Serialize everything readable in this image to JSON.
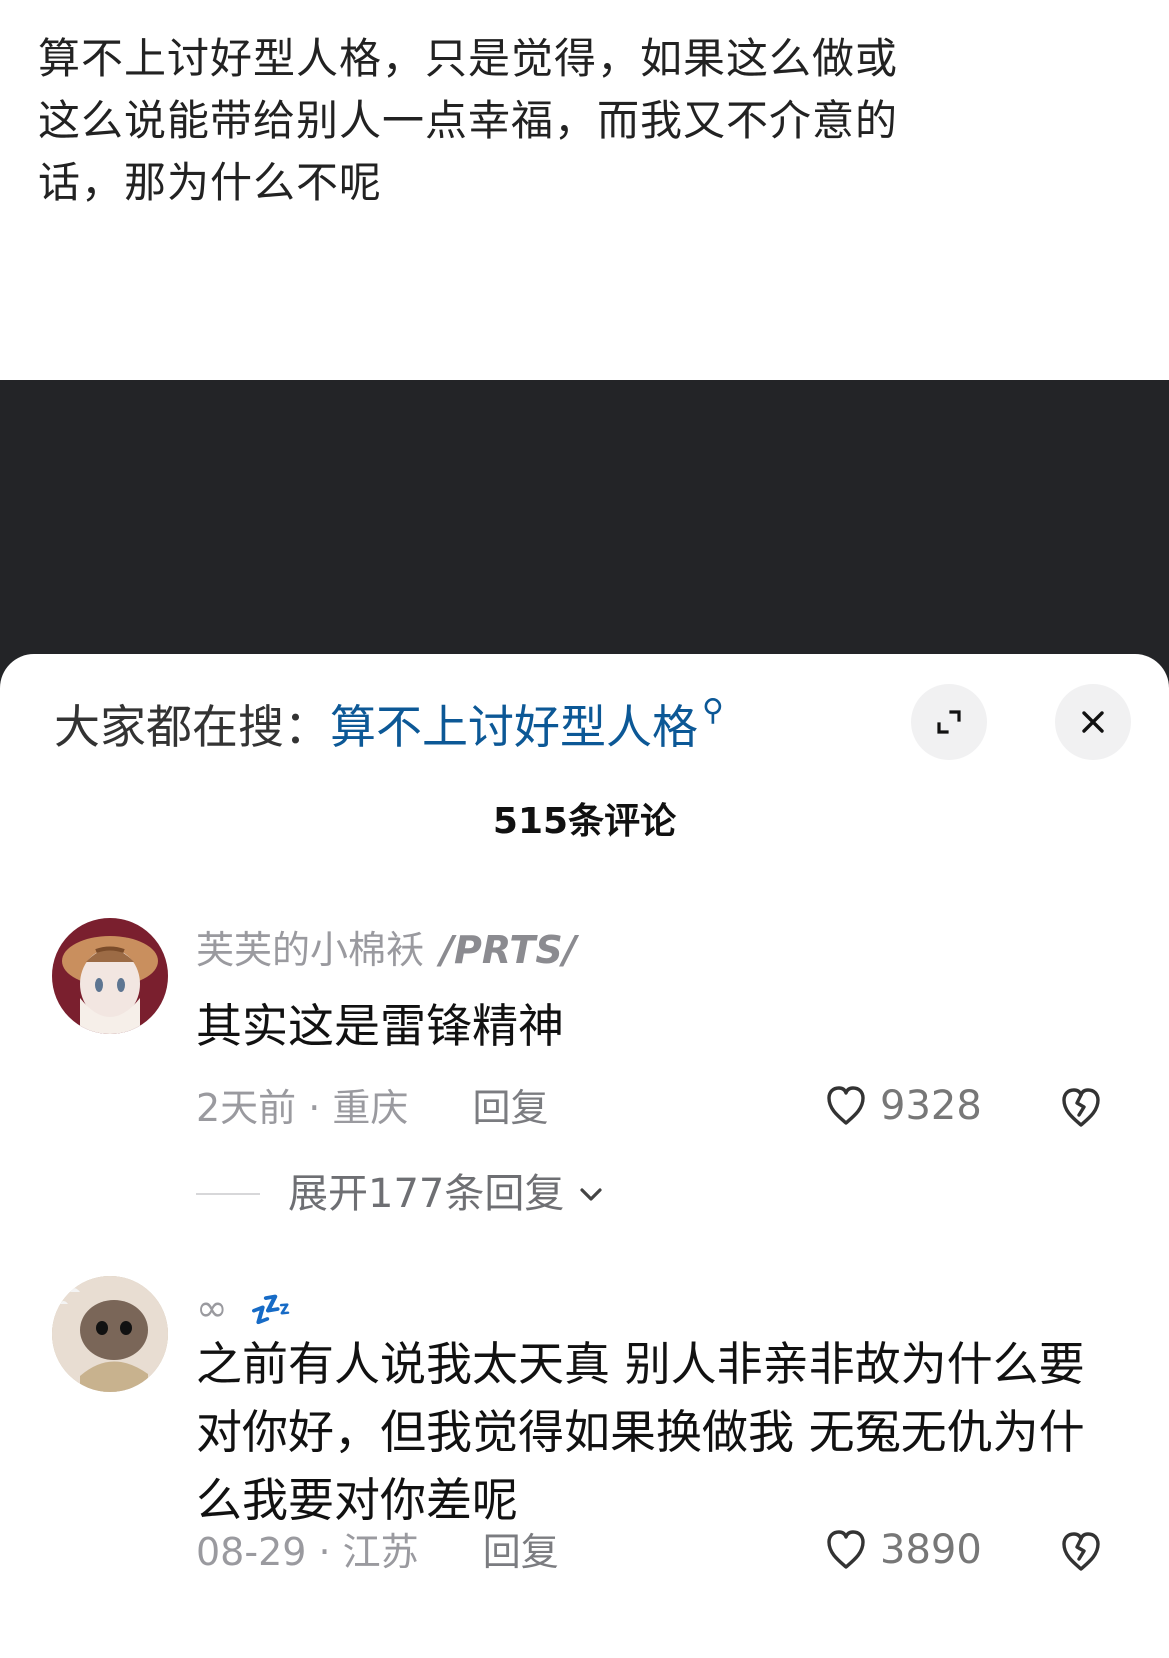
{
  "post": {
    "caption": "算不上讨好型人格，只是觉得，如果这么做或这么说能带给别人一点幸福，而我又不介意的话，那为什么不呢"
  },
  "comment_panel": {
    "search_prefix": "大家都在搜：",
    "search_term": "算不上讨好型人格",
    "count_label": "515条评论"
  },
  "comments": [
    {
      "author": "芙芙的小棉袄",
      "author_suffix": "/PRTS/",
      "text": "其实这是雷锋精神",
      "time_location": "2天前 · 重庆",
      "reply_label": "回复",
      "likes": "9328",
      "expand_label": "展开177条回复"
    },
    {
      "author": "∞",
      "text": "之前有人说我太天真 别人非亲非故为什么要对你好，但我觉得如果换做我 无冤无仇为什么我要对你差呢",
      "time_location": "08-29 · 江苏",
      "reply_label": "回复",
      "likes": "3890"
    }
  ],
  "icons": {
    "search": "search-icon",
    "expand": "expand-icon",
    "close": "close-icon",
    "like": "heart-icon",
    "dislike": "broken-heart-icon",
    "expand_replies": "chevron-down-icon",
    "sleep": "sleep-icon"
  }
}
